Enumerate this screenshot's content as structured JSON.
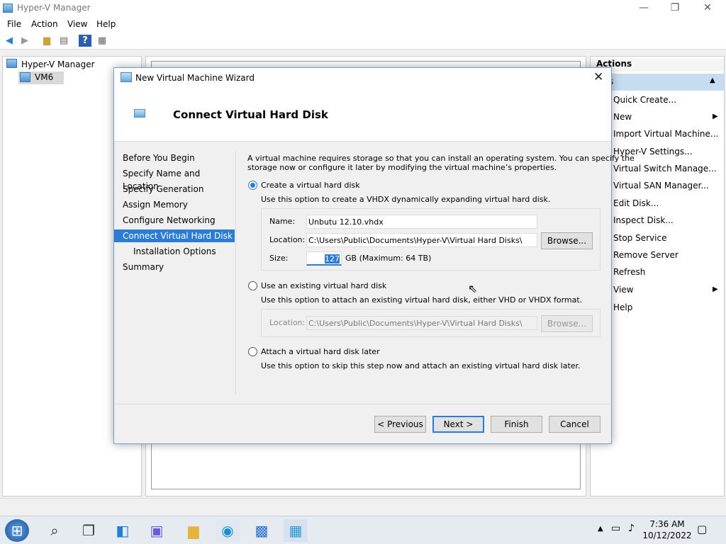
{
  "window": {
    "title": "Hyper-V Manager",
    "min_glyph": "—",
    "max_glyph": "❐",
    "close_glyph": "✕"
  },
  "menu": [
    "File",
    "Action",
    "View",
    "Help"
  ],
  "toolbar_icons": [
    "back-icon",
    "forward-icon",
    "up-folder-icon",
    "show-hide-tree-icon",
    "help-icon",
    "properties-icon"
  ],
  "tree": {
    "root": "Hyper-V Manager",
    "child": "VM6"
  },
  "actions": {
    "header": "Actions",
    "selected_fragment": "s",
    "items": [
      "Quick Create...",
      "New",
      "Import Virtual Machine...",
      "Hyper-V Settings...",
      "Virtual Switch Manage...",
      "Virtual SAN Manager...",
      "Edit Disk...",
      "Inspect Disk...",
      "Stop Service",
      "Remove Server",
      "Refresh",
      "View",
      "Help"
    ]
  },
  "dialog": {
    "title": "New Virtual Machine Wizard",
    "close_glyph": "✕",
    "heading": "Connect Virtual Hard Disk",
    "nav": [
      "Before You Begin",
      "Specify Name and Location",
      "Specify Generation",
      "Assign Memory",
      "Configure Networking",
      "Connect Virtual Hard Disk",
      "Installation Options",
      "Summary"
    ],
    "selected_nav": "Connect Virtual Hard Disk",
    "intro_line1": "A virtual machine requires storage so that you can install an operating system. You can specify the",
    "intro_line2": "storage now or configure it later by modifying the virtual machine’s properties.",
    "opt_create": {
      "label": "Create a virtual hard disk",
      "desc": "Use this option to create a VHDX dynamically expanding virtual hard disk.",
      "name_label": "Name:",
      "name_value": "Unbutu 12.10.vhdx",
      "location_label": "Location:",
      "location_value": "C:\\Users\\Public\\Documents\\Hyper-V\\Virtual Hard Disks\\",
      "browse": "Browse...",
      "size_label": "Size:",
      "size_value": "127",
      "size_unit": "GB (Maximum: 64 TB)"
    },
    "opt_existing": {
      "label": "Use an existing virtual hard disk",
      "desc": "Use this option to attach an existing virtual hard disk, either VHD or VHDX format.",
      "location_label": "Location:",
      "location_value": "C:\\Users\\Public\\Documents\\Hyper-V\\Virtual Hard Disks\\",
      "browse": "Browse..."
    },
    "opt_later": {
      "label": "Attach a virtual hard disk later",
      "desc": "Use this option to skip this step now and attach an existing virtual hard disk later."
    },
    "buttons": {
      "previous": "< Previous",
      "next": "Next >",
      "finish": "Finish",
      "cancel": "Cancel"
    }
  },
  "taskbar": {
    "time": "7:36 AM",
    "date": "10/12/2022"
  },
  "colors": {
    "accent": "#2b7cd3",
    "selection_light": "#c5dcf1"
  }
}
